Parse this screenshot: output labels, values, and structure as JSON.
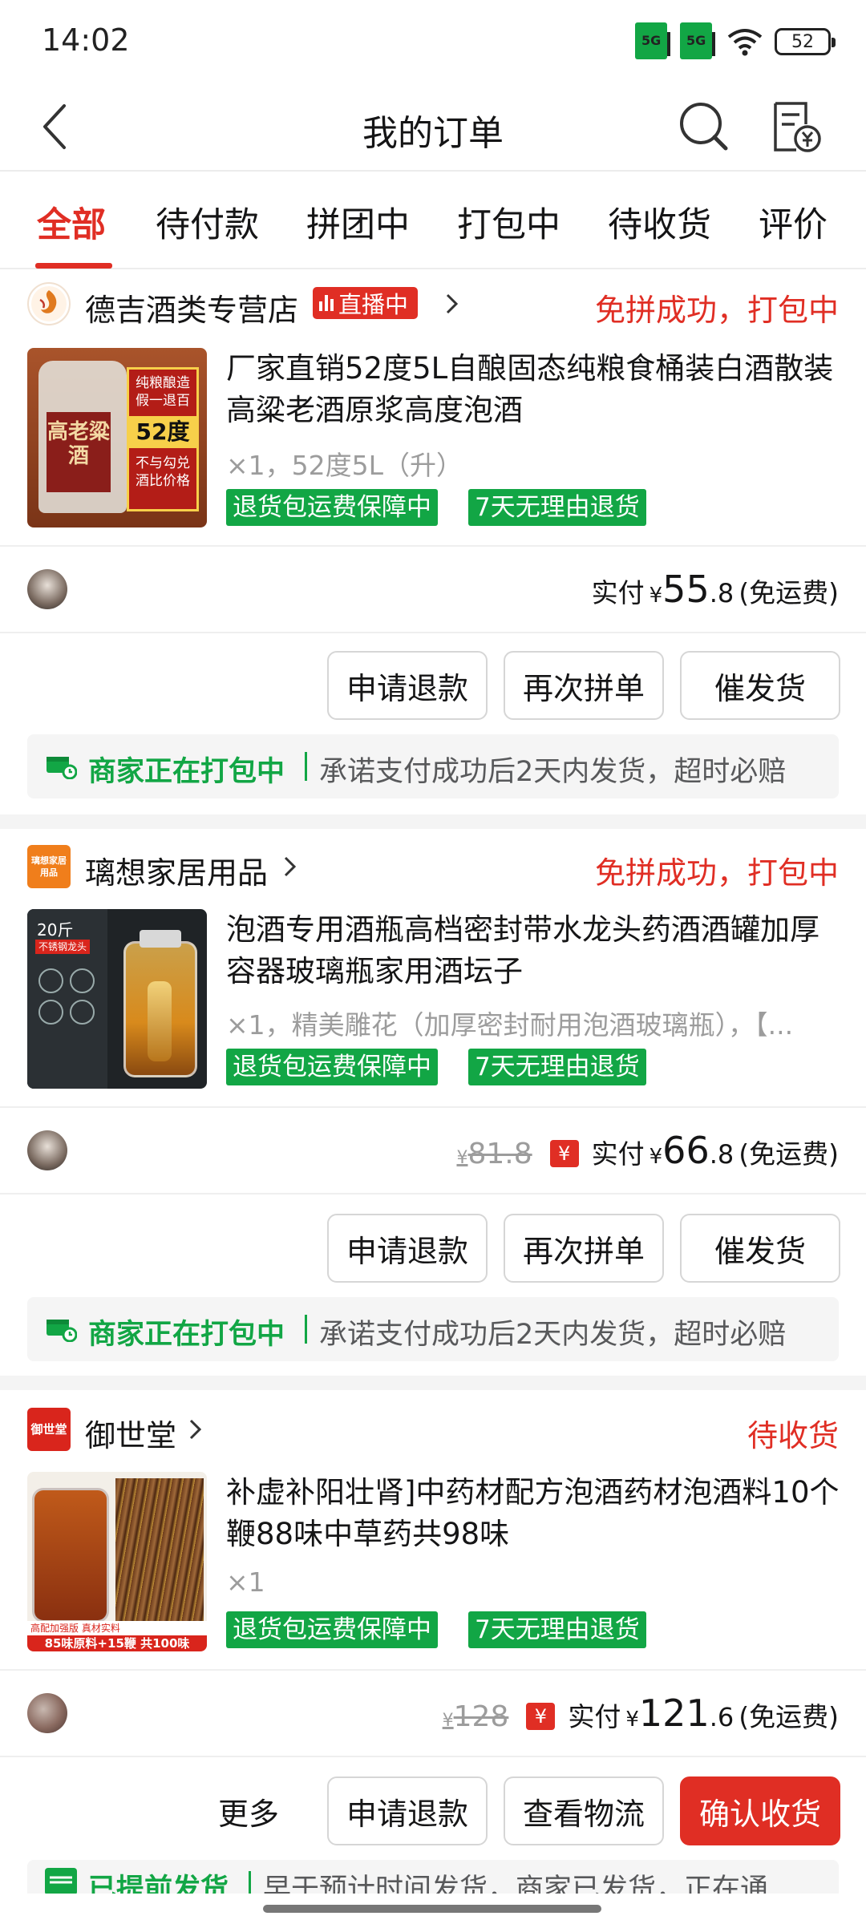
{
  "status_bar": {
    "time": "14:02",
    "signal1": "5G",
    "signal2": "5G",
    "battery": "52"
  },
  "header": {
    "title": "我的订单",
    "back_icon": "chevron-left-icon",
    "search_icon": "search-icon",
    "bill_icon": "bill-yuan-icon"
  },
  "tabs": [
    {
      "label": "全部",
      "active": true
    },
    {
      "label": "待付款"
    },
    {
      "label": "拼团中"
    },
    {
      "label": "打包中"
    },
    {
      "label": "待收货"
    },
    {
      "label": "评价"
    }
  ],
  "orders": [
    {
      "shop": "德吉酒类专营店",
      "live_badge": "直播中",
      "status": "免拼成功，打包中",
      "title": "厂家直销52度5L自酿固态纯粮食桶装白酒散装高粱老酒原浆高度泡酒",
      "spec": "×1，52度5L（升）",
      "img_text": {
        "line1": "纯粮酿造",
        "line2": "假一退百",
        "degree": "52度",
        "line3": "不与勾兑",
        "line4": "酒比价格",
        "brand": "高老粱酒"
      },
      "tags": [
        "退货包运费保障中",
        "7天无理由退货"
      ],
      "paid_label": "实付",
      "yuan": "¥",
      "paid_int": "55",
      "paid_dec": ".8",
      "freight": "(免运费)",
      "buttons": [
        "申请退款",
        "再次拼单",
        "催发货"
      ],
      "notice_strong": "商家正在打包中",
      "notice_text": "承诺支付成功后2天内发货，超时必赔"
    },
    {
      "shop": "璃想家居用品",
      "logo_text": "璃想家居用品",
      "status": "免拼成功，打包中",
      "title": "泡酒专用酒瓶高档密封带水龙头药酒酒罐加厚容器玻璃瓶家用酒坛子",
      "spec": "×1，精美雕花（加厚密封耐用泡酒玻璃瓶），【...",
      "img_text": {
        "label": "20斤",
        "sub": "不锈钢龙头"
      },
      "tags": [
        "退货包运费保障中",
        "7天无理由退货"
      ],
      "original_yuan": "¥",
      "original_price": "81.8",
      "coupon_icon": "¥",
      "paid_label": "实付",
      "yuan": "¥",
      "paid_int": "66",
      "paid_dec": ".8",
      "freight": "(免运费)",
      "buttons": [
        "申请退款",
        "再次拼单",
        "催发货"
      ],
      "notice_strong": "商家正在打包中",
      "notice_text": "承诺支付成功后2天内发货，超时必赔"
    },
    {
      "shop": "御世堂",
      "logo_text": "御世堂",
      "status": "待收货",
      "title": "补虚补阳壮肾]中药材配方泡酒药材泡酒料10个鞭88味中草药共98味",
      "spec": "×1",
      "img_text": {
        "line1": "高配加强版 真材实料",
        "line2": "85味原料+15鞭 共100味"
      },
      "tags": [
        "退货包运费保障中",
        "7天无理由退货"
      ],
      "original_yuan": "¥",
      "original_price": "128",
      "coupon_icon": "¥",
      "paid_label": "实付",
      "yuan": "¥",
      "paid_int": "121",
      "paid_dec": ".6",
      "freight": "(免运费)",
      "more": "更多",
      "buttons": [
        "申请退款",
        "查看物流",
        "确认收货"
      ],
      "notice_strong": "已提前发货",
      "notice_text": "早于预计时间发货，商家已发货，正在通"
    }
  ]
}
